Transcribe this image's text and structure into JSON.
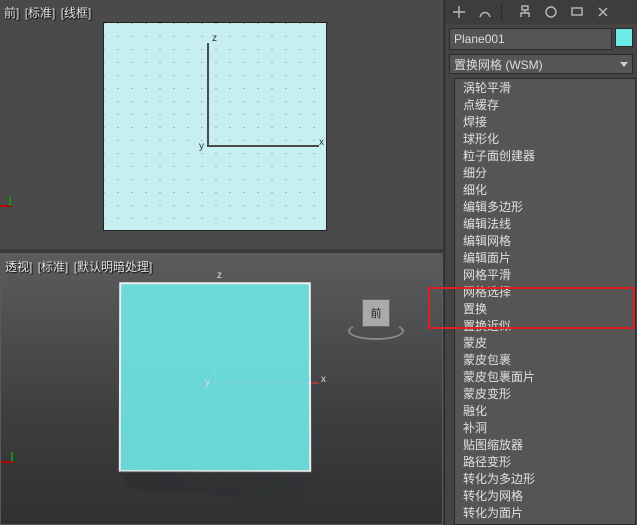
{
  "viewport_top": {
    "label_a": "前]",
    "label_b": "[标准]",
    "label_c": "[线框]",
    "axis_z": "z",
    "axis_x": "x",
    "origin": "y"
  },
  "viewport_bottom": {
    "label_a": "透视]",
    "label_b": "[标准]",
    "label_c": "[默认明暗处理]",
    "axis_z": "z",
    "axis_x": "x",
    "origin": "y",
    "cube_face": "前"
  },
  "panel": {
    "object_name": "Plane001",
    "modifier_dropdown": "置换网格 (WSM)"
  },
  "modifier_list": [
    "涡轮平滑",
    "点缓存",
    "焊接",
    "球形化",
    "粒子面创建器",
    "细分",
    "细化",
    "编辑多边形",
    "编辑法线",
    "编辑网格",
    "编辑面片",
    "网格平滑",
    "网格选择",
    "置换",
    "置换近似",
    "蒙皮",
    "蒙皮包裹",
    "蒙皮包裹面片",
    "蒙皮变形",
    "融化",
    "补洞",
    "贴图缩放器",
    "路径变形",
    "转化为多边形",
    "转化为网格",
    "转化为面片"
  ],
  "highlight_index": 13
}
